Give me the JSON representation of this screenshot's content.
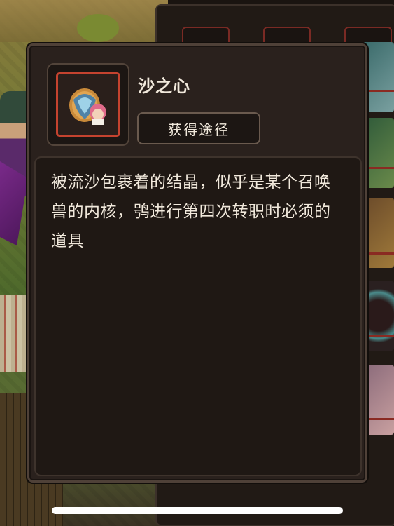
{
  "item": {
    "name": "沙之心",
    "icon": "sand-heart-crystal-icon",
    "frame_color": "#c5432f"
  },
  "actions": {
    "source_label": "获得途径"
  },
  "description": {
    "text": "被流沙包裹着的结晶，似乎是某个召唤兽的内核，鸮进行第四次转职时必须的道具"
  },
  "colors": {
    "text": "#f1e9dc",
    "popup_bg": "#2a211d",
    "desc_bg": "#1f1814",
    "accent_red": "#c5432f"
  }
}
